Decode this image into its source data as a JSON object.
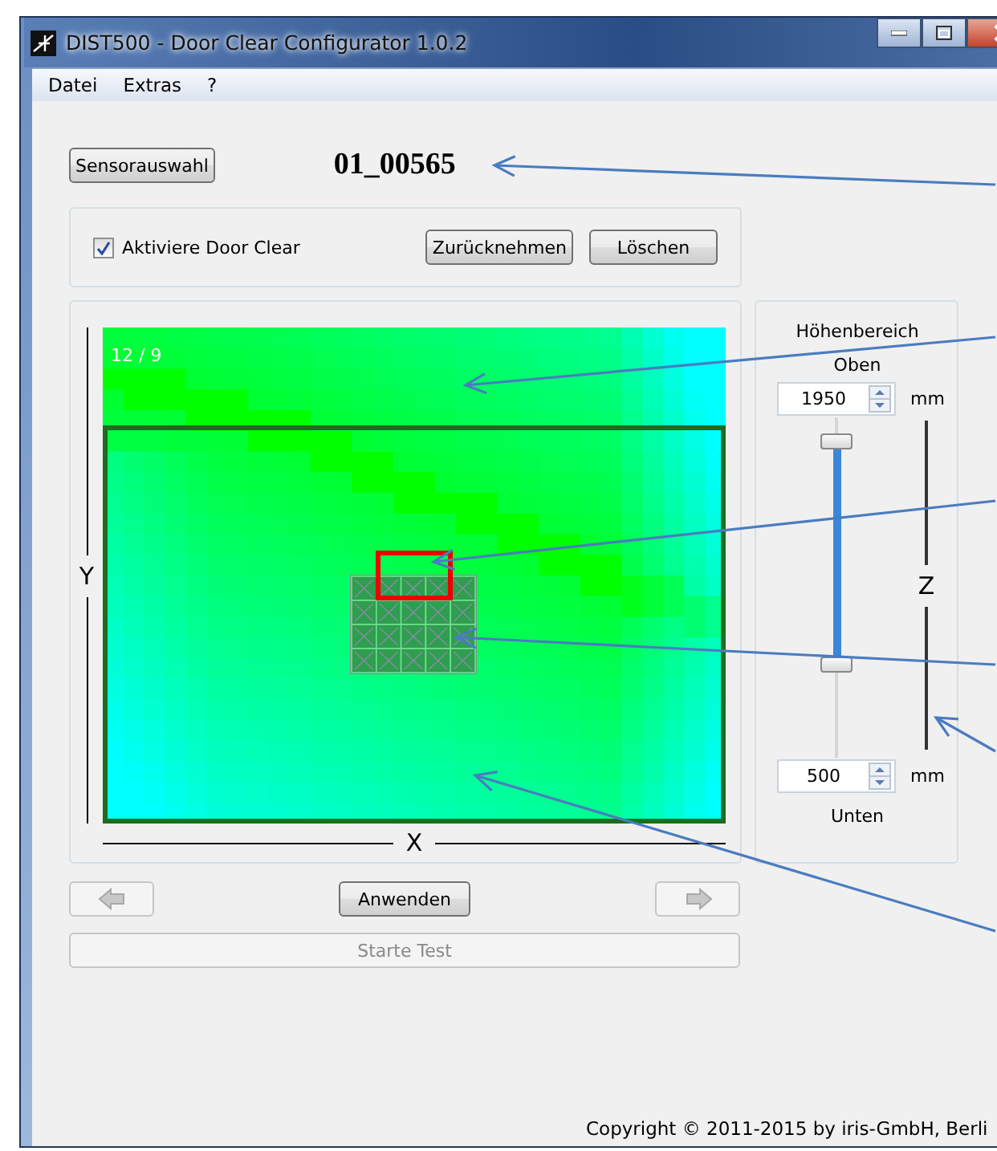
{
  "window": {
    "title": "DIST500 - Door Clear Configurator 1.0.2"
  },
  "menu": [
    "Datei",
    "Extras",
    "?"
  ],
  "sensor_button": "Sensorauswahl",
  "sensor_id": "01_00565",
  "door_clear": {
    "label": "Aktiviere Door Clear",
    "checked": true
  },
  "edit_buttons": [
    "Zurücknehmen",
    "Löschen"
  ],
  "heatmap": {
    "label": "12 / 9",
    "y_axis": "Y",
    "x_axis": "X"
  },
  "height_range": {
    "title": "Höhenbereich",
    "upper_label": "Oben",
    "upper_value": "1950",
    "upper_unit": "mm",
    "handles": [
      {
        "level": 0.95
      },
      {
        "level": 0.26
      }
    ],
    "z_axis": "Z",
    "lower_value": "500",
    "lower_unit": "mm",
    "lower_label": "Unten"
  },
  "nav": {
    "prev_disabled": true,
    "apply": "Anwenden",
    "next_disabled": true
  },
  "test_button": {
    "label": "Starte Test",
    "disabled": true
  },
  "copyright": "Copyright © 2011-2015 by iris-GmbH, Berli"
}
